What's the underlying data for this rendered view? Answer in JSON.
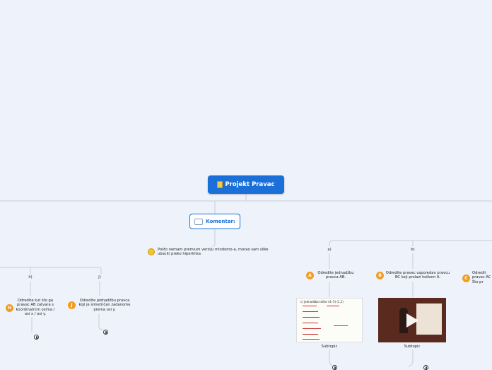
{
  "central": {
    "label": "Projekt Pravac",
    "icon": "notebook-icon"
  },
  "comment": {
    "label": "Komentar:",
    "icon": "speech-bubble-icon"
  },
  "note": {
    "text": "Pošto nemam premium verziju mindomo-a, morao sam slike ubaciti preko hiperlinka",
    "icon": "laughing-emoji-icon"
  },
  "branches": {
    "a": {
      "letter": "a)",
      "badge": "A",
      "text": "Odredite jednadžbu pravca AB.",
      "image_caption": "Subtopic",
      "image_text": "c) jednadžba točke (4,-5) (1,1)"
    },
    "b": {
      "letter": "b)",
      "badge": "B",
      "text": "Odredite pravac usporedan pravcu BC koji prolazi točkom A.",
      "image_caption": "Subtopic"
    },
    "c": {
      "badge": "C",
      "text_lines": [
        "Odredit",
        "pravac AC",
        "Što pr"
      ]
    },
    "h": {
      "letter": "h)",
      "badge": "H",
      "text": "Odredite kut što ga pravac AB zatvara s koordinatnim osima / osi x / osi y."
    },
    "j": {
      "letter": "j)",
      "badge": "J",
      "text": "Odredite jednadžbu pravca koji je simetričan zadanome prema osi y."
    }
  },
  "colors": {
    "central": "#1a6fd8",
    "badge": "#f39c1f",
    "line": "#c7cdd8"
  }
}
